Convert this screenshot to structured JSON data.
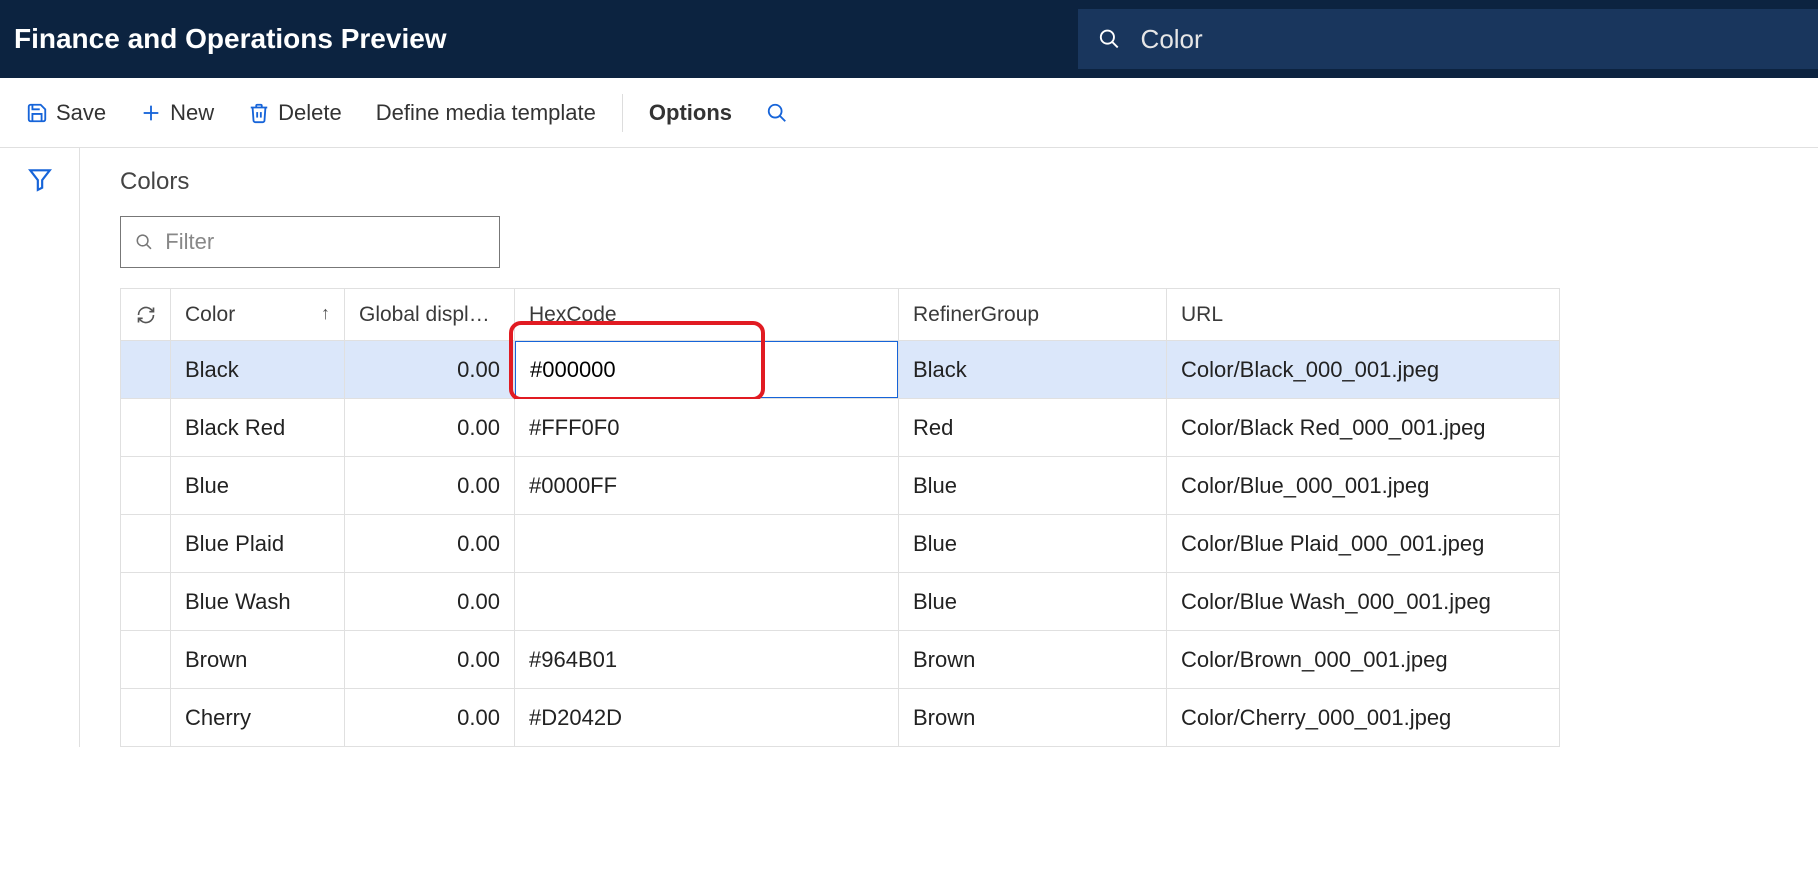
{
  "appbar": {
    "title": "Finance and Operations Preview",
    "search_value": "Color"
  },
  "toolbar": {
    "save": "Save",
    "new": "New",
    "delete": "Delete",
    "define_media": "Define media template",
    "options": "Options"
  },
  "page": {
    "heading": "Colors",
    "filter_placeholder": "Filter"
  },
  "columns": {
    "color": "Color",
    "global_display": "Global display ...",
    "hexcode": "HexCode",
    "refiner": "RefinerGroup",
    "url": "URL"
  },
  "rows": [
    {
      "color": "Black",
      "global_display": "0.00",
      "hexcode": "#000000",
      "refiner": "Black",
      "url": "Color/Black_000_001.jpeg",
      "selected": true,
      "editing": true
    },
    {
      "color": "Black Red",
      "global_display": "0.00",
      "hexcode": "#FFF0F0",
      "refiner": "Red",
      "url": "Color/Black Red_000_001.jpeg",
      "selected": false,
      "editing": false
    },
    {
      "color": "Blue",
      "global_display": "0.00",
      "hexcode": "#0000FF",
      "refiner": "Blue",
      "url": "Color/Blue_000_001.jpeg",
      "selected": false,
      "editing": false
    },
    {
      "color": "Blue Plaid",
      "global_display": "0.00",
      "hexcode": "",
      "refiner": "Blue",
      "url": "Color/Blue Plaid_000_001.jpeg",
      "selected": false,
      "editing": false
    },
    {
      "color": "Blue Wash",
      "global_display": "0.00",
      "hexcode": "",
      "refiner": "Blue",
      "url": "Color/Blue Wash_000_001.jpeg",
      "selected": false,
      "editing": false
    },
    {
      "color": "Brown",
      "global_display": "0.00",
      "hexcode": "#964B01",
      "refiner": "Brown",
      "url": "Color/Brown_000_001.jpeg",
      "selected": false,
      "editing": false
    },
    {
      "color": "Cherry",
      "global_display": "0.00",
      "hexcode": "#D2042D",
      "refiner": "Brown",
      "url": "Color/Cherry_000_001.jpeg",
      "selected": false,
      "editing": false
    }
  ]
}
